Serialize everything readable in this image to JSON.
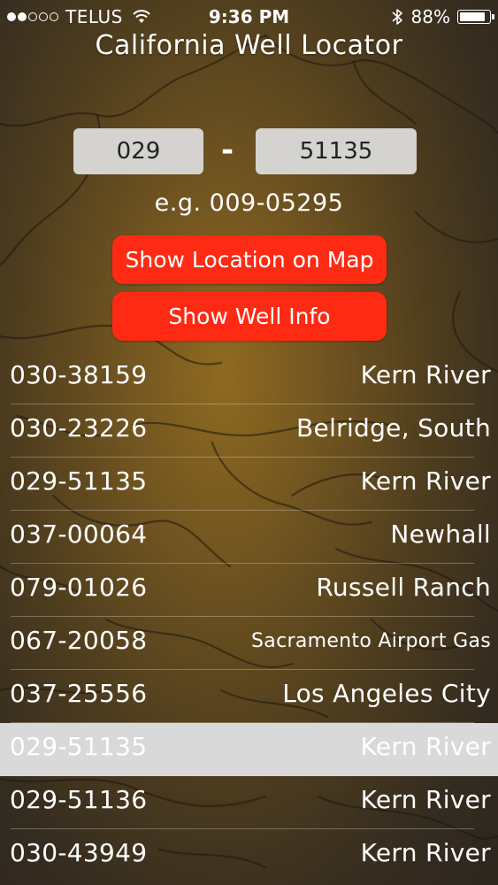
{
  "status_bar": {
    "carrier": "TELUS",
    "time": "9:36 PM",
    "battery_percent": "88%",
    "battery_level": 0.88,
    "signal_bars_filled": 2,
    "signal_bars_total": 5,
    "icons": [
      "wifi-icon",
      "bluetooth-icon",
      "battery-icon"
    ]
  },
  "app": {
    "title": "California Well Locator"
  },
  "search": {
    "prefix_value": "029",
    "separator": "-",
    "number_value": "51135",
    "example": "e.g. 009-05295"
  },
  "buttons": {
    "show_map": "Show Location on Map",
    "show_info": "Show Well Info"
  },
  "colors": {
    "accent_button": "#ff2a14",
    "input_background": "#d4d3cf",
    "selected_row": "#d9d9d9"
  },
  "wells": [
    {
      "id": "030-38159",
      "field": "Kern River"
    },
    {
      "id": "030-23226",
      "field": "Belridge, South"
    },
    {
      "id": "029-51135",
      "field": "Kern River"
    },
    {
      "id": "037-00064",
      "field": "Newhall"
    },
    {
      "id": "079-01026",
      "field": "Russell Ranch"
    },
    {
      "id": "067-20058",
      "field": "Sacramento Airport Gas"
    },
    {
      "id": "037-25556",
      "field": "Los Angeles City"
    },
    {
      "id": "029-51135",
      "field": "Kern River"
    },
    {
      "id": "029-51136",
      "field": "Kern River"
    },
    {
      "id": "030-43949",
      "field": "Kern River"
    }
  ]
}
